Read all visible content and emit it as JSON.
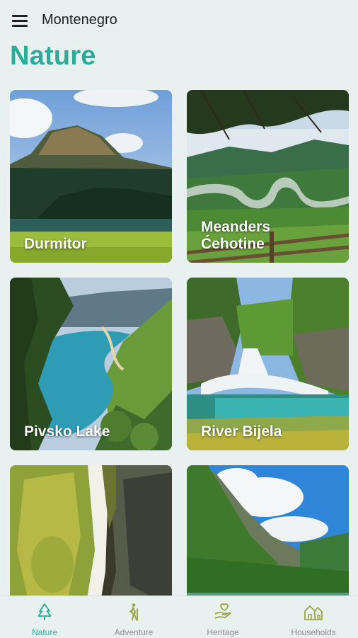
{
  "header": {
    "app_title": "Montenegro",
    "menu_icon": "hamburger-menu-icon"
  },
  "page": {
    "title": "Nature",
    "title_color": "#2bab98"
  },
  "cards": [
    {
      "label": "Durmitor"
    },
    {
      "label": "Meanders\nĆehotine"
    },
    {
      "label": "Pivsko Lake"
    },
    {
      "label": "River Bijela"
    },
    {
      "label": ""
    },
    {
      "label": ""
    }
  ],
  "bottom_nav": {
    "active_color": "#2bab98",
    "inactive_color": "#8a8a8a",
    "items": [
      {
        "label": "Nature",
        "icon": "tree-icon",
        "active": true
      },
      {
        "label": "Adventure",
        "icon": "hiker-icon",
        "active": false
      },
      {
        "label": "Heritage",
        "icon": "hand-heart-icon",
        "active": false
      },
      {
        "label": "Households",
        "icon": "houses-icon",
        "active": false
      }
    ]
  }
}
